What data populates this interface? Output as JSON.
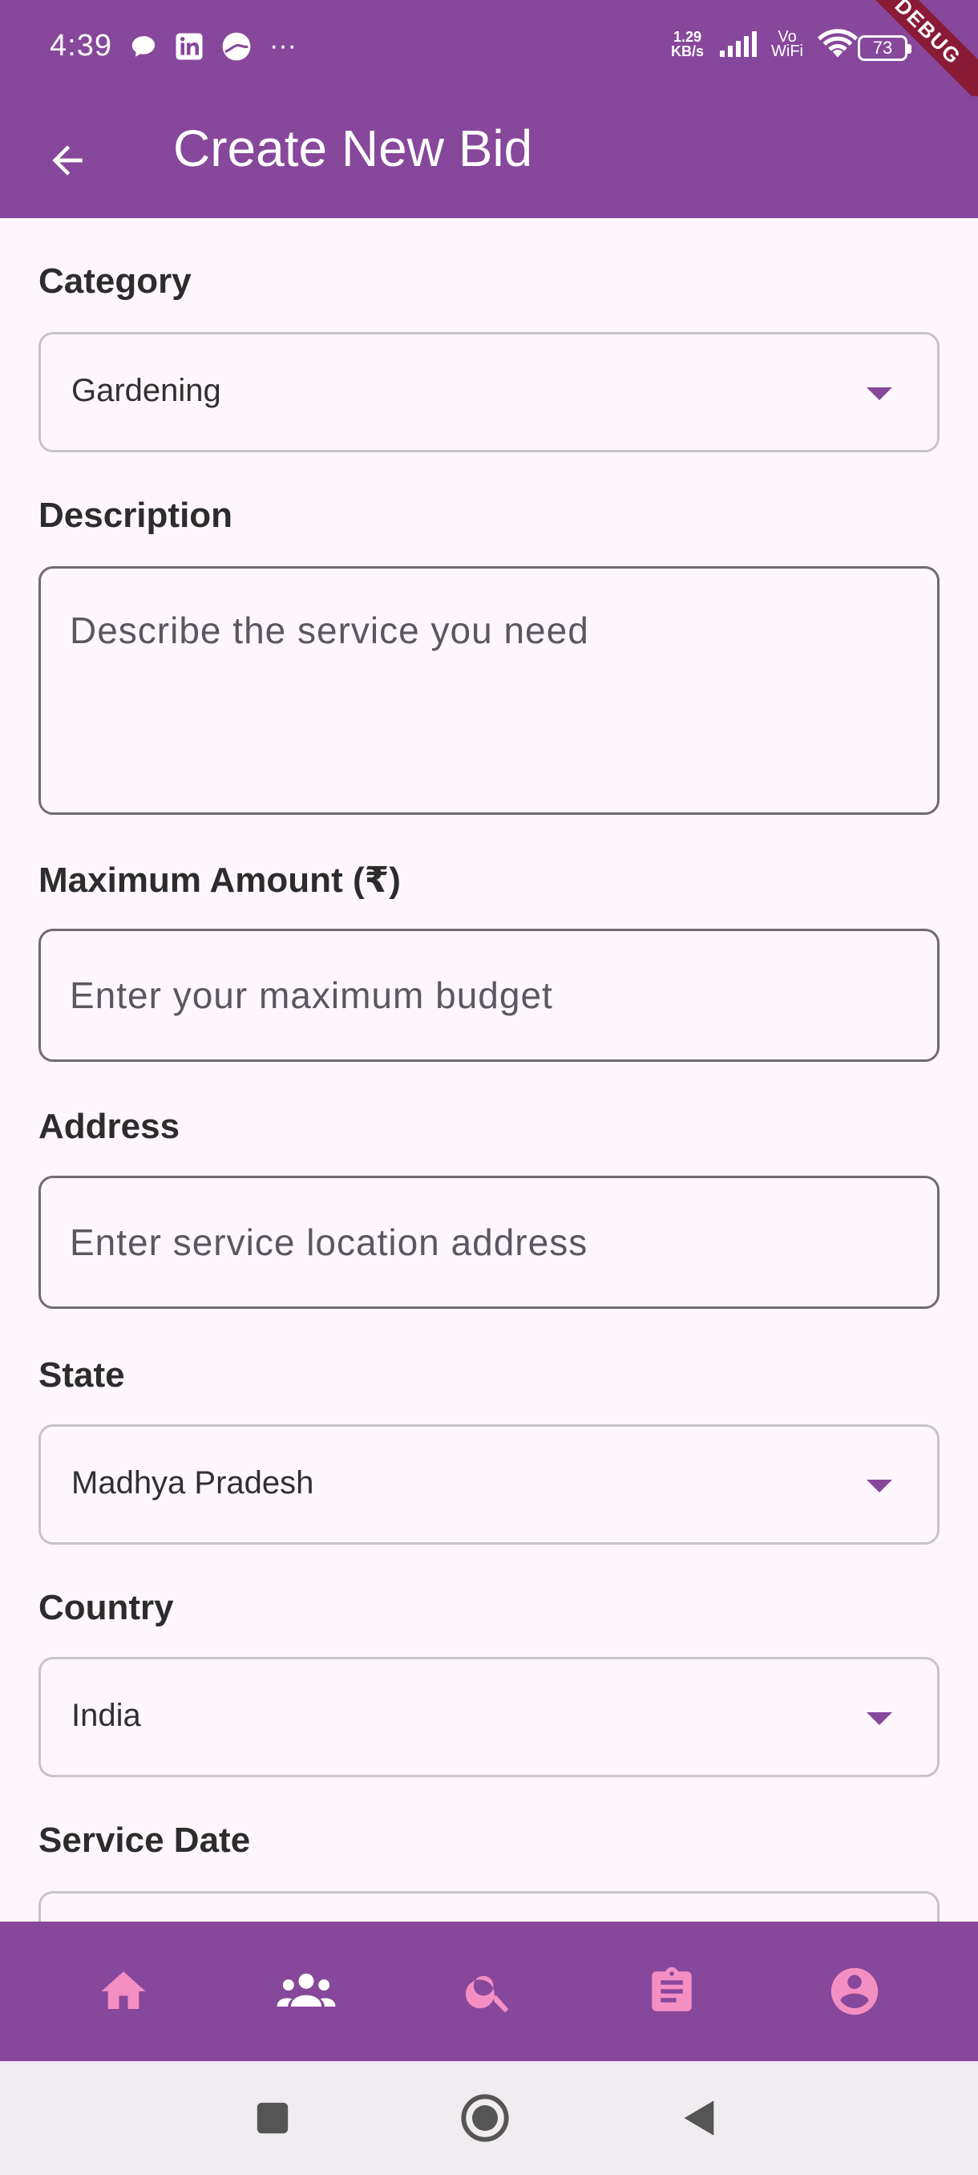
{
  "status_bar": {
    "time": "4:39",
    "more": "···",
    "net_speed_value": "1.29",
    "net_speed_unit": "KB/s",
    "vowifi_top": "Vo",
    "vowifi_bottom": "WiFi",
    "battery": "73",
    "debug_banner": "DEBUG"
  },
  "app_bar": {
    "title": "Create New Bid",
    "back_icon": "arrow-back-icon"
  },
  "form": {
    "category": {
      "label": "Category",
      "value": "Gardening"
    },
    "description": {
      "label": "Description",
      "placeholder": "Describe the service you need"
    },
    "max_amount": {
      "label": "Maximum Amount (₹)",
      "placeholder": "Enter your maximum budget"
    },
    "address": {
      "label": "Address",
      "placeholder": "Enter service location address"
    },
    "state": {
      "label": "State",
      "value": "Madhya Pradesh"
    },
    "country": {
      "label": "Country",
      "value": "India"
    },
    "service_date": {
      "label": "Service Date"
    }
  },
  "bottom_nav": {
    "items": [
      "home-icon",
      "people-icon",
      "search-icon",
      "assignment-icon",
      "account-circle-icon"
    ]
  },
  "system_nav": {
    "items": [
      "recents-icon",
      "home-circle-icon",
      "back-triangle-icon"
    ]
  },
  "colors": {
    "primary": "#87479b",
    "nav_icon": "#f48fc3",
    "background": "#fdf7fd"
  }
}
